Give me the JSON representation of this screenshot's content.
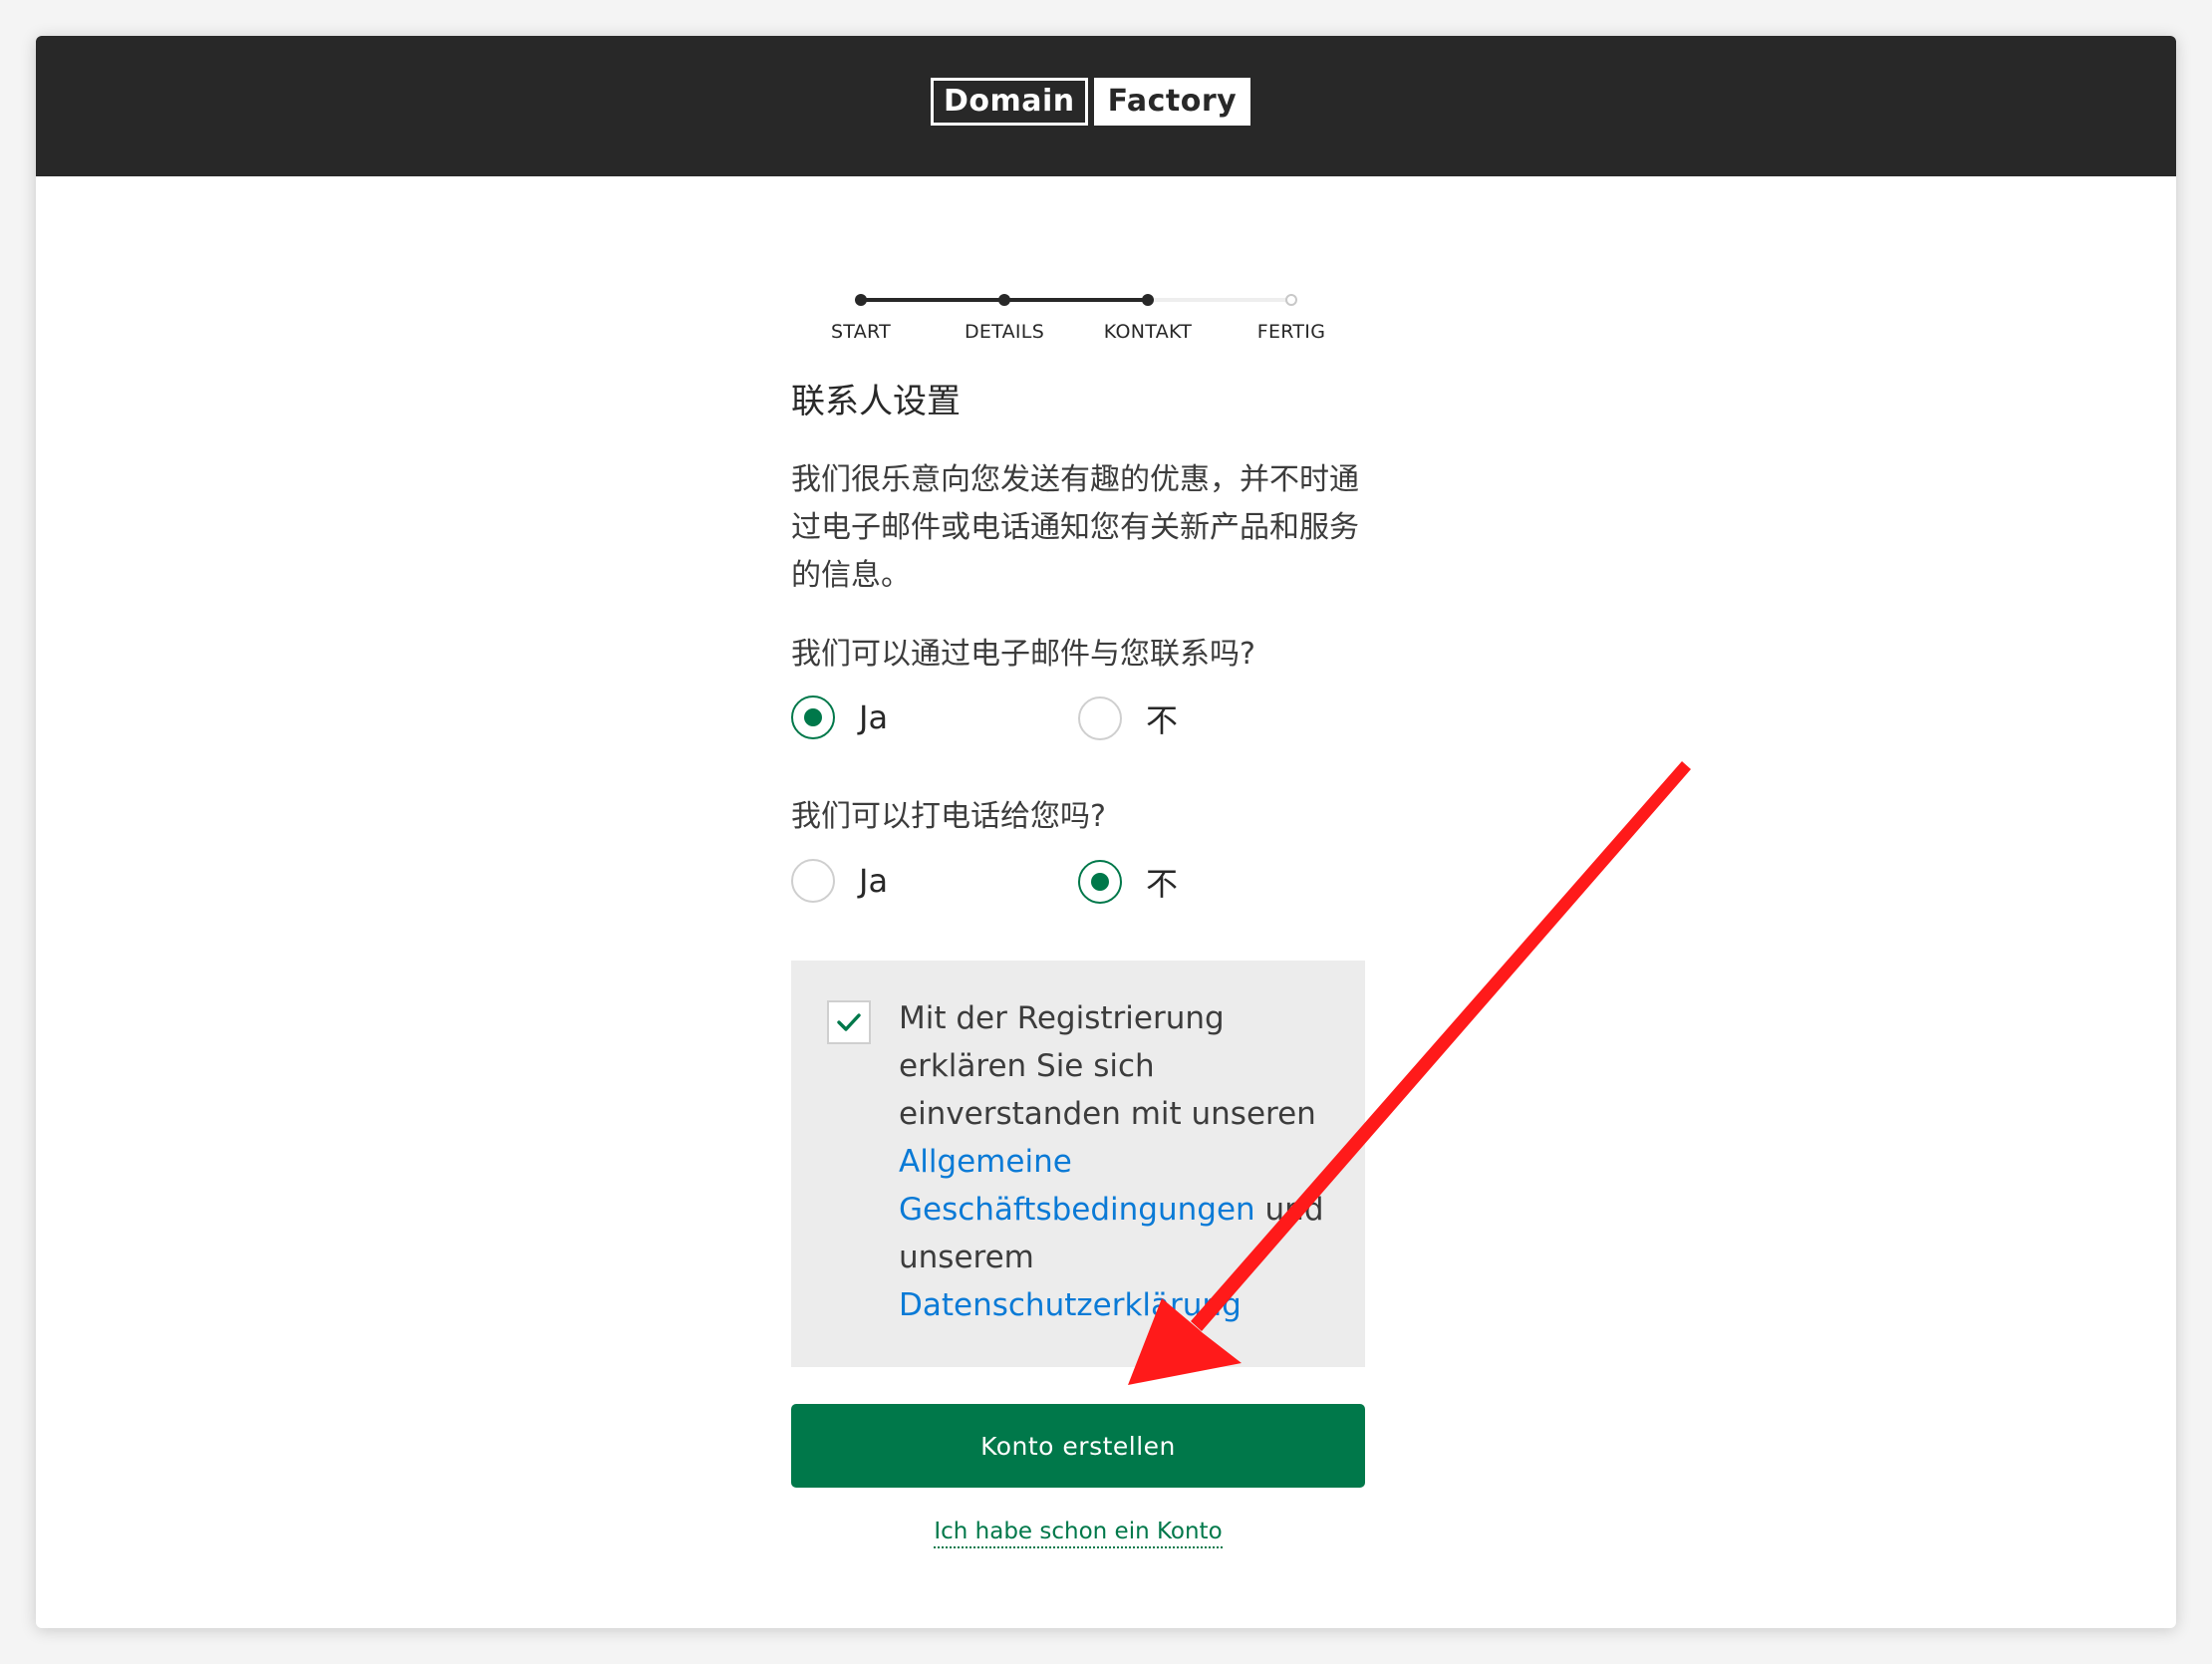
{
  "header": {
    "logo_left": "Domain",
    "logo_right": "Factory",
    "background_color": "#282828"
  },
  "stepper": {
    "steps": [
      {
        "label": "START",
        "state": "done"
      },
      {
        "label": "DETAILS",
        "state": "done"
      },
      {
        "label": "KONTAKT",
        "state": "current"
      },
      {
        "label": "FERTIG",
        "state": "todo"
      }
    ]
  },
  "form": {
    "title": "联系人设置",
    "intro": "我们很乐意向您发送有趣的优惠，并不时通过电子邮件或电话通知您有关新产品和服务的信息。",
    "email_question": {
      "label": "我们可以通过电子邮件与您联系吗?",
      "options": [
        {
          "label": "Ja",
          "selected": true
        },
        {
          "label": "不",
          "selected": false
        }
      ]
    },
    "phone_question": {
      "label": "我们可以打电话给您吗?",
      "options": [
        {
          "label": "Ja",
          "selected": false
        },
        {
          "label": "不",
          "selected": true
        }
      ]
    },
    "consent": {
      "checked": true,
      "text_before": "Mit der Registrierung erklären Sie sich einverstanden mit unseren ",
      "terms_link": "Allgemeine Geschäftsbedingungen",
      "text_middle": " und unserem ",
      "privacy_link": "Datenschutzerklärung"
    },
    "submit_label": "Konto erstellen",
    "login_link": "Ich habe schon ein Konto"
  },
  "colors": {
    "accent": "#00784a",
    "link": "#0a7ad6",
    "annotation_arrow": "#ff1a1a"
  }
}
